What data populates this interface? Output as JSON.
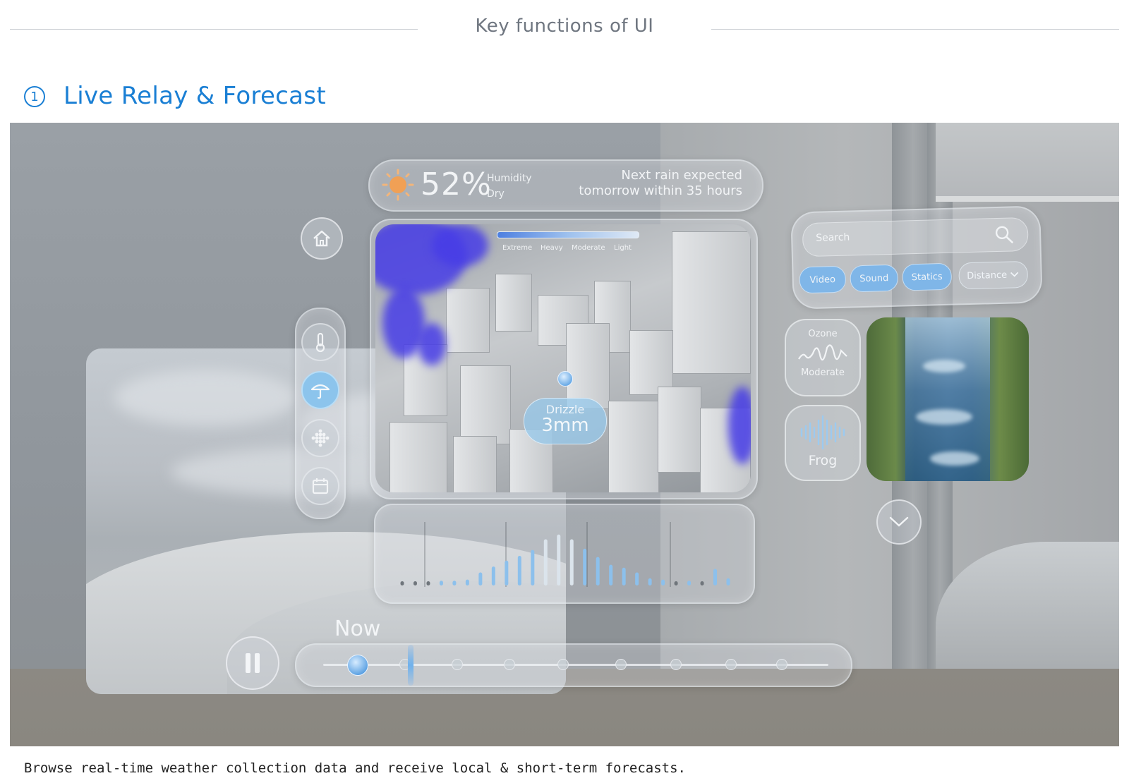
{
  "header": {
    "title": "Key functions of UI"
  },
  "section": {
    "number": "1",
    "title": "Live Relay & Forecast"
  },
  "caption": "Browse real-time weather collection data and receive local & short-term forecasts.",
  "status": {
    "percent": "52%",
    "humidity_label": "Humidity",
    "humidity_state": "Dry",
    "next_rain_line1": "Next rain expected",
    "next_rain_line2": "tomorrow within 35 hours"
  },
  "map": {
    "legend": [
      "Extreme",
      "Heavy",
      "Moderate",
      "Light"
    ],
    "callout_label": "Drizzle",
    "callout_value": "3mm"
  },
  "search": {
    "placeholder": "Search",
    "chips": [
      {
        "label": "Video",
        "active": true
      },
      {
        "label": "Sound",
        "active": true
      },
      {
        "label": "Statics",
        "active": true
      },
      {
        "label": "Distance",
        "active": false
      }
    ]
  },
  "tiles": {
    "ozone_label": "Ozone",
    "ozone_value": "Moderate",
    "sound_label": "Frog"
  },
  "timeline": {
    "now_label": "Now"
  },
  "rail": {
    "items": [
      "thermometer-icon",
      "umbrella-icon",
      "grid-icon",
      "calendar-icon"
    ],
    "active_index": 1
  },
  "colors": {
    "accent": "#1a7fd4",
    "active": "#8cc4ec",
    "sun": "#f0a055"
  },
  "chart_data": {
    "type": "bar",
    "values": [
      0.05,
      0.05,
      0.05,
      0.08,
      0.08,
      0.1,
      0.22,
      0.32,
      0.42,
      0.5,
      0.6,
      0.78,
      0.86,
      0.78,
      0.62,
      0.48,
      0.35,
      0.3,
      0.22,
      0.12,
      0.1,
      0.05,
      0.08,
      0.05,
      0.28,
      0.12
    ],
    "ylim": [
      0,
      1
    ]
  }
}
